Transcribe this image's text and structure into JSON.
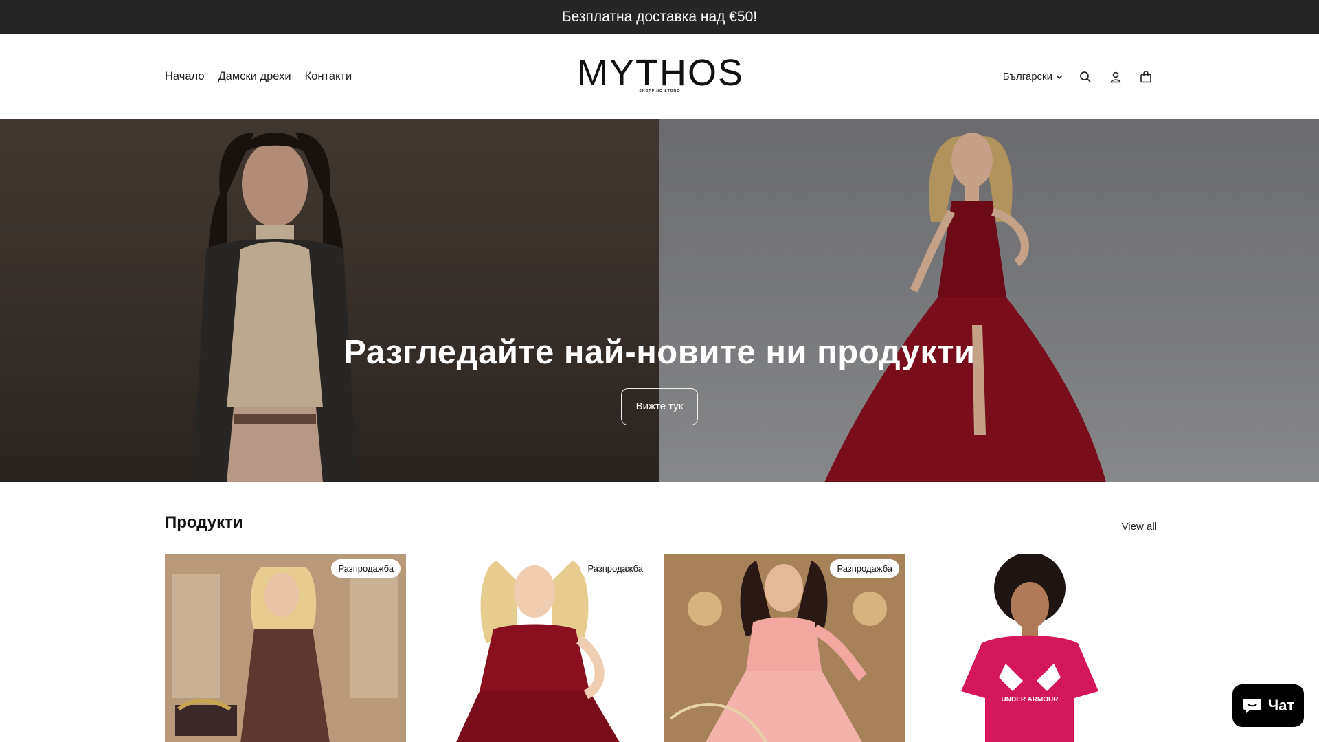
{
  "announcement": {
    "text": "Безплатна доставка над €50!"
  },
  "nav": {
    "items": [
      "Начало",
      "Дамски дрехи",
      "Контакти"
    ]
  },
  "logo": {
    "main": "MYTHOS",
    "sub": "SHOPPING STORE"
  },
  "header": {
    "language": "Български"
  },
  "icons": {
    "search": "search-icon",
    "account": "account-icon",
    "cart": "cart-icon",
    "chevron": "chevron-down-icon",
    "chat": "chat-icon"
  },
  "hero": {
    "title": "Разгледайте най-новите ни продукти",
    "button": "Вижте тук"
  },
  "products": {
    "title": "Продукти",
    "view_all": "View all",
    "items": [
      {
        "badge": "Разпродажба",
        "color": "#7a5a48"
      },
      {
        "badge": "Разпродажба",
        "color": "#ffffff"
      },
      {
        "badge": "Разпродажба",
        "color": "#a37a4e"
      },
      {
        "badge": "",
        "color": "#ffffff",
        "shirt_text": "UNDER ARMOUR"
      }
    ]
  },
  "chat": {
    "label": "Чат"
  },
  "colors": {
    "announcement_bg": "#262626",
    "dress_red": "#8a0f1f",
    "shirt_pink": "#d4165a"
  }
}
